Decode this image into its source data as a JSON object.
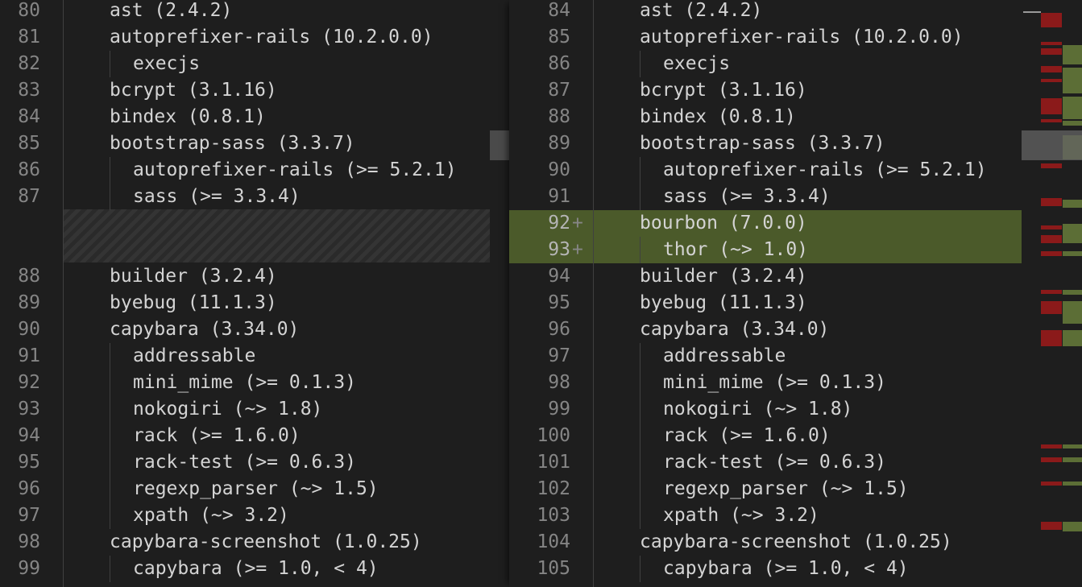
{
  "colors": {
    "background": "#1e1e1e",
    "inserted_line": "#4b5a2a",
    "deleted_mark": "#8b1a1a",
    "inserted_mark": "#5c6e36"
  },
  "left": {
    "rows": [
      {
        "ln": "80",
        "text": "ast (2.4.2)",
        "indent": 0
      },
      {
        "ln": "81",
        "text": "autoprefixer-rails (10.2.0.0)",
        "indent": 0
      },
      {
        "ln": "82",
        "text": "execjs",
        "indent": 1
      },
      {
        "ln": "83",
        "text": "bcrypt (3.1.16)",
        "indent": 0
      },
      {
        "ln": "84",
        "text": "bindex (0.8.1)",
        "indent": 0
      },
      {
        "ln": "85",
        "text": "bootstrap-sass (3.3.7)",
        "indent": 0
      },
      {
        "ln": "86",
        "text": "autoprefixer-rails (>= 5.2.1)",
        "indent": 1
      },
      {
        "ln": "87",
        "text": "sass (>= 3.3.4)",
        "indent": 1
      },
      {
        "spacer": true
      },
      {
        "spacer": true
      },
      {
        "ln": "88",
        "text": "builder (3.2.4)",
        "indent": 0
      },
      {
        "ln": "89",
        "text": "byebug (11.1.3)",
        "indent": 0
      },
      {
        "ln": "90",
        "text": "capybara (3.34.0)",
        "indent": 0
      },
      {
        "ln": "91",
        "text": "addressable",
        "indent": 1
      },
      {
        "ln": "92",
        "text": "mini_mime (>= 0.1.3)",
        "indent": 1
      },
      {
        "ln": "93",
        "text": "nokogiri (~> 1.8)",
        "indent": 1
      },
      {
        "ln": "94",
        "text": "rack (>= 1.6.0)",
        "indent": 1
      },
      {
        "ln": "95",
        "text": "rack-test (>= 0.6.3)",
        "indent": 1
      },
      {
        "ln": "96",
        "text": "regexp_parser (~> 1.5)",
        "indent": 1
      },
      {
        "ln": "97",
        "text": "xpath (~> 3.2)",
        "indent": 1
      },
      {
        "ln": "98",
        "text": "capybara-screenshot (1.0.25)",
        "indent": 0
      },
      {
        "ln": "99",
        "text": "capybara (>= 1.0, < 4)",
        "indent": 1
      }
    ]
  },
  "right": {
    "rows": [
      {
        "ln": "84",
        "text": "ast (2.4.2)",
        "indent": 0
      },
      {
        "ln": "85",
        "text": "autoprefixer-rails (10.2.0.0)",
        "indent": 0
      },
      {
        "ln": "86",
        "text": "execjs",
        "indent": 1
      },
      {
        "ln": "87",
        "text": "bcrypt (3.1.16)",
        "indent": 0
      },
      {
        "ln": "88",
        "text": "bindex (0.8.1)",
        "indent": 0
      },
      {
        "ln": "89",
        "text": "bootstrap-sass (3.3.7)",
        "indent": 0
      },
      {
        "ln": "90",
        "text": "autoprefixer-rails (>= 5.2.1)",
        "indent": 1
      },
      {
        "ln": "91",
        "text": "sass (>= 3.3.4)",
        "indent": 1
      },
      {
        "ln": "92",
        "text": "bourbon (7.0.0)",
        "indent": 0,
        "marker": "+",
        "inserted": true
      },
      {
        "ln": "93",
        "text": "thor (~> 1.0)",
        "indent": 1,
        "marker": "+",
        "inserted": true
      },
      {
        "ln": "94",
        "text": "builder (3.2.4)",
        "indent": 0
      },
      {
        "ln": "95",
        "text": "byebug (11.1.3)",
        "indent": 0
      },
      {
        "ln": "96",
        "text": "capybara (3.34.0)",
        "indent": 0
      },
      {
        "ln": "97",
        "text": "addressable",
        "indent": 1
      },
      {
        "ln": "98",
        "text": "mini_mime (>= 0.1.3)",
        "indent": 1
      },
      {
        "ln": "99",
        "text": "nokogiri (~> 1.8)",
        "indent": 1
      },
      {
        "ln": "100",
        "text": "rack (>= 1.6.0)",
        "indent": 1
      },
      {
        "ln": "101",
        "text": "rack-test (>= 0.6.3)",
        "indent": 1
      },
      {
        "ln": "102",
        "text": "regexp_parser (~> 1.5)",
        "indent": 1
      },
      {
        "ln": "103",
        "text": "xpath (~> 3.2)",
        "indent": 1
      },
      {
        "ln": "104",
        "text": "capybara-screenshot (1.0.25)",
        "indent": 0
      },
      {
        "ln": "105",
        "text": "capybara (>= 1.0, < 4)",
        "indent": 1
      }
    ]
  }
}
